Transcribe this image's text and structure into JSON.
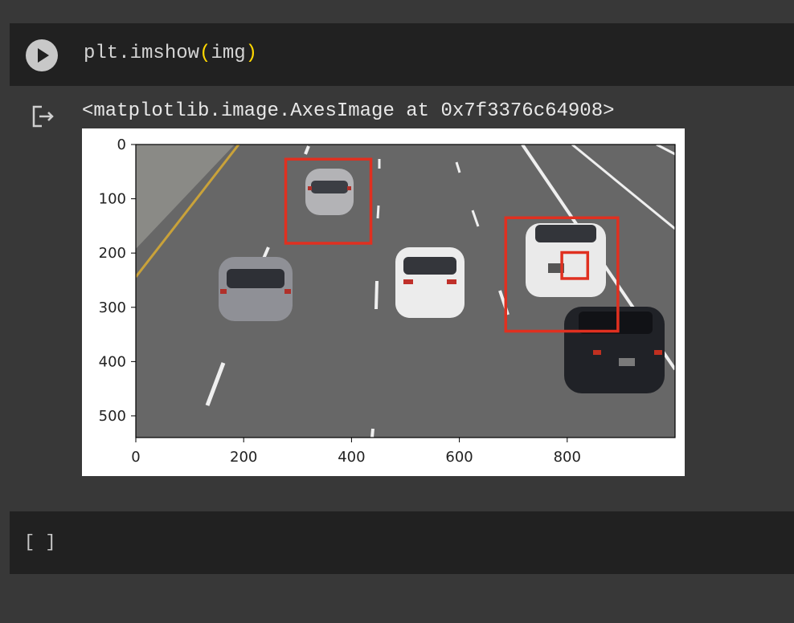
{
  "code_cell": {
    "fn": "plt.imshow",
    "open_paren": "(",
    "arg": "img",
    "close_paren": ")"
  },
  "output": {
    "text": "<matplotlib.image.AxesImage at 0x7f3376c64908>"
  },
  "chart_data": {
    "type": "image",
    "x_ticks": [
      "0",
      "200",
      "400",
      "600",
      "800"
    ],
    "y_ticks": [
      "0",
      "100",
      "200",
      "300",
      "400",
      "500"
    ],
    "xlim": [
      0,
      1000
    ],
    "ylim": [
      540,
      0
    ],
    "boxes": [
      {
        "x0": 278,
        "y0": 27,
        "x1": 436,
        "y1": 182
      },
      {
        "x0": 686,
        "y0": 135,
        "x1": 894,
        "y1": 344
      },
      {
        "x0": 790,
        "y0": 199,
        "x1": 838,
        "y1": 247
      }
    ],
    "box_color": "#e03020"
  },
  "empty_cell": {
    "brackets": "[ ]"
  }
}
